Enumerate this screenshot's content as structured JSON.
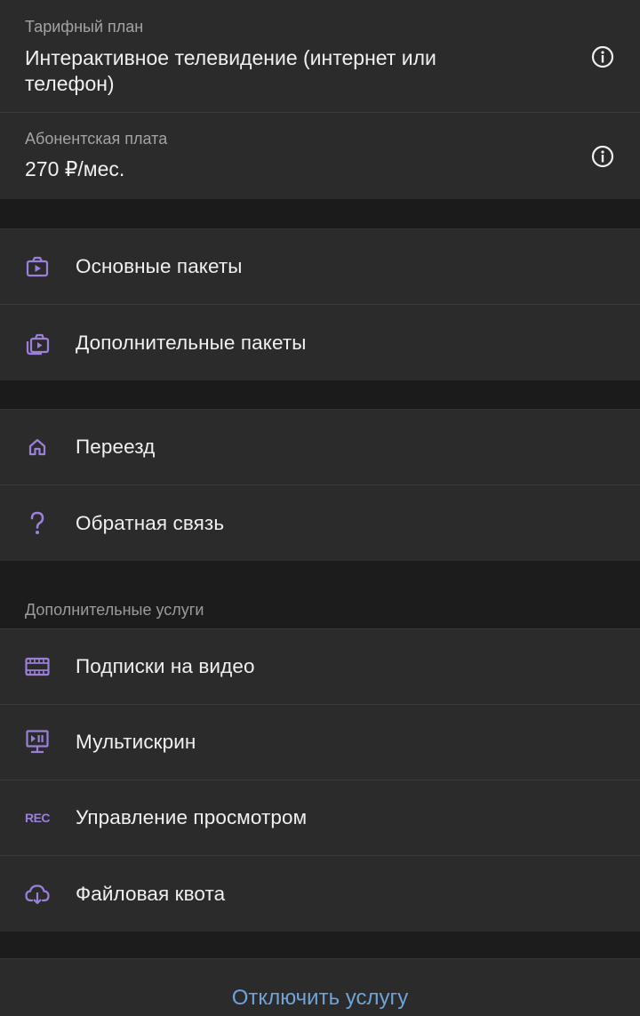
{
  "tariff": {
    "plan_label": "Тарифный план",
    "plan_value": "Интерактивное телевидение (интернет или телефон)",
    "fee_label": "Абонентская плата",
    "fee_value": "270 ₽/мес."
  },
  "packages": [
    {
      "label": "Основные пакеты",
      "icon": "tv-package-icon"
    },
    {
      "label": "Дополнительные пакеты",
      "icon": "stacked-packages-icon"
    }
  ],
  "misc": [
    {
      "label": "Переезд",
      "icon": "home-icon"
    },
    {
      "label": "Обратная связь",
      "icon": "question-icon"
    }
  ],
  "extra_services": {
    "title": "Дополнительные услуги",
    "items": [
      {
        "label": "Подписки на видео",
        "icon": "film-strip-icon"
      },
      {
        "label": "Мультискрин",
        "icon": "multiscreen-icon"
      },
      {
        "label": "Управление просмотром",
        "icon": "rec-icon",
        "icon_text": "REC"
      },
      {
        "label": "Файловая квота",
        "icon": "cloud-download-icon"
      }
    ]
  },
  "bottom_action": "Отключить услугу",
  "colors": {
    "accent_icon": "#9b7fd9",
    "link": "#6fa3d9",
    "card_bg": "#2b2b2b",
    "page_bg": "#1c1c1c"
  }
}
